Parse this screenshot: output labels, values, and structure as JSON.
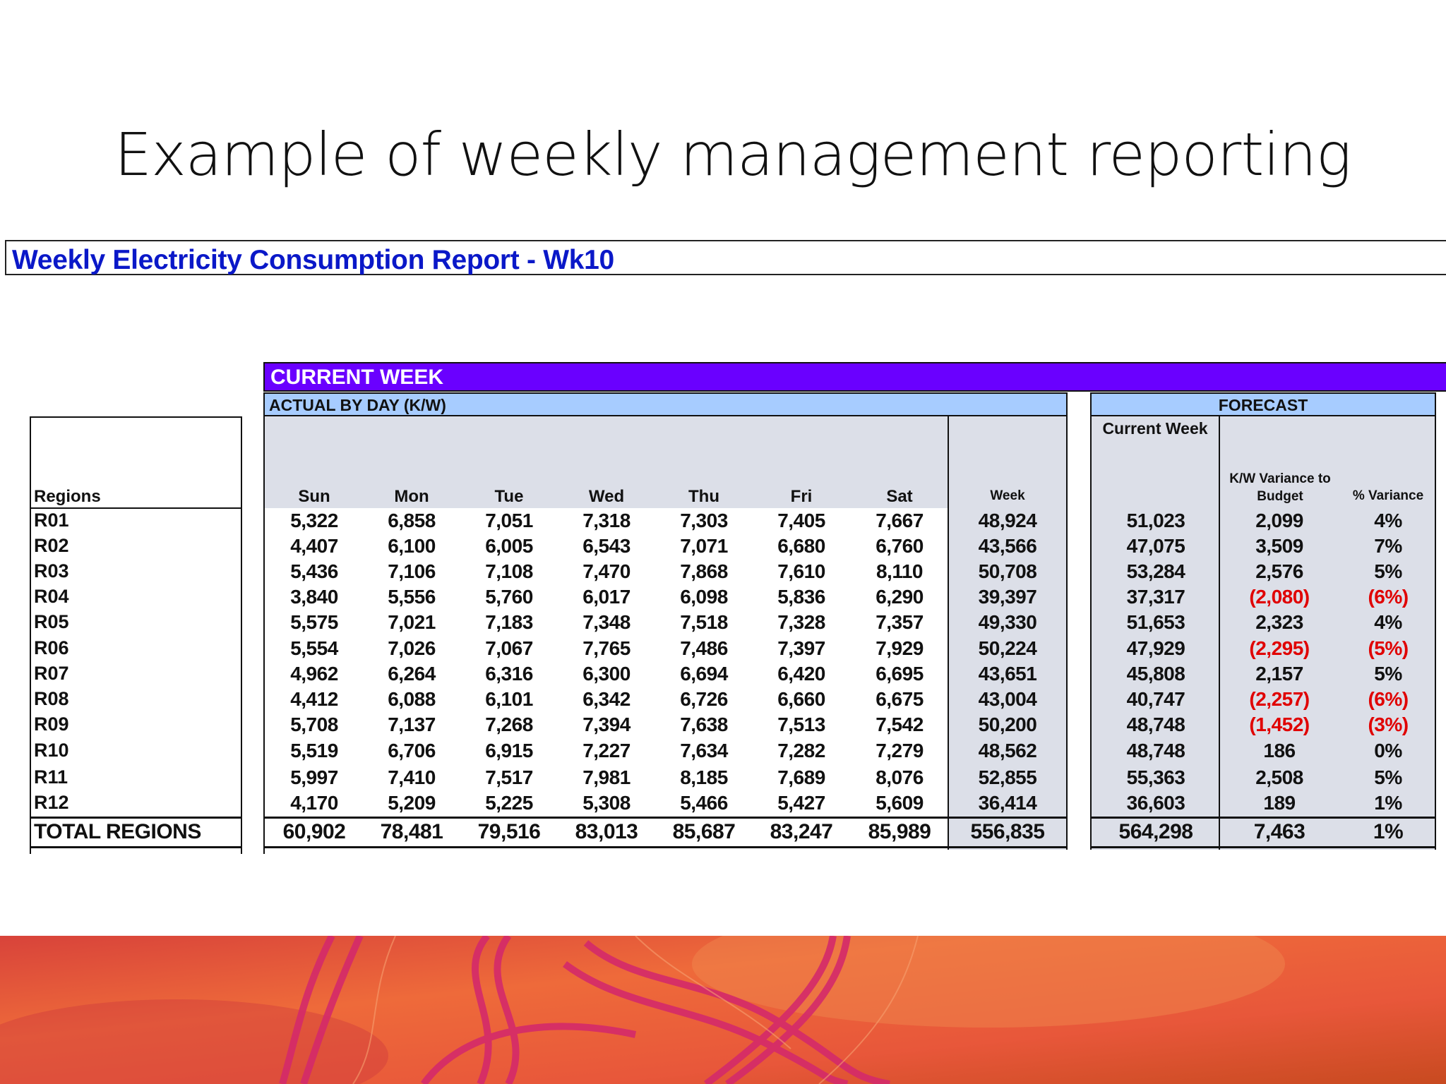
{
  "slide": {
    "title": "Example of weekly management reporting"
  },
  "report": {
    "title": "Weekly Electricity Consumption Report - Wk10",
    "current_week_label": "CURRENT WEEK",
    "actual_label": "ACTUAL BY DAY (K/W)",
    "forecast_label": "FORECAST",
    "headers": {
      "regions": "Regions",
      "days": [
        "Sun",
        "Mon",
        "Tue",
        "Wed",
        "Thu",
        "Fri",
        "Sat"
      ],
      "week": "Week",
      "current_week": "Current Week",
      "kw_variance": "K/W Variance to Budget",
      "pct_variance": "% Variance"
    },
    "rows": [
      {
        "region": "R01",
        "days": [
          "5,322",
          "6,858",
          "7,051",
          "7,318",
          "7,303",
          "7,405",
          "7,667"
        ],
        "week": "48,924",
        "forecast": "51,023",
        "variance": "2,099",
        "pct": "4%",
        "negative": false
      },
      {
        "region": "R02",
        "days": [
          "4,407",
          "6,100",
          "6,005",
          "6,543",
          "7,071",
          "6,680",
          "6,760"
        ],
        "week": "43,566",
        "forecast": "47,075",
        "variance": "3,509",
        "pct": "7%",
        "negative": false
      },
      {
        "region": "R03",
        "days": [
          "5,436",
          "7,106",
          "7,108",
          "7,470",
          "7,868",
          "7,610",
          "8,110"
        ],
        "week": "50,708",
        "forecast": "53,284",
        "variance": "2,576",
        "pct": "5%",
        "negative": false
      },
      {
        "region": "R04",
        "days": [
          "3,840",
          "5,556",
          "5,760",
          "6,017",
          "6,098",
          "5,836",
          "6,290"
        ],
        "week": "39,397",
        "forecast": "37,317",
        "variance": "(2,080)",
        "pct": "(6%)",
        "negative": true
      },
      {
        "region": "R05",
        "days": [
          "5,575",
          "7,021",
          "7,183",
          "7,348",
          "7,518",
          "7,328",
          "7,357"
        ],
        "week": "49,330",
        "forecast": "51,653",
        "variance": "2,323",
        "pct": "4%",
        "negative": false
      },
      {
        "region": "R06",
        "days": [
          "5,554",
          "7,026",
          "7,067",
          "7,765",
          "7,486",
          "7,397",
          "7,929"
        ],
        "week": "50,224",
        "forecast": "47,929",
        "variance": "(2,295)",
        "pct": "(5%)",
        "negative": true
      },
      {
        "region": "R07",
        "days": [
          "4,962",
          "6,264",
          "6,316",
          "6,300",
          "6,694",
          "6,420",
          "6,695"
        ],
        "week": "43,651",
        "forecast": "45,808",
        "variance": "2,157",
        "pct": "5%",
        "negative": false
      },
      {
        "region": "R08",
        "days": [
          "4,412",
          "6,088",
          "6,101",
          "6,342",
          "6,726",
          "6,660",
          "6,675"
        ],
        "week": "43,004",
        "forecast": "40,747",
        "variance": "(2,257)",
        "pct": "(6%)",
        "negative": true
      },
      {
        "region": "R09",
        "days": [
          "5,708",
          "7,137",
          "7,268",
          "7,394",
          "7,638",
          "7,513",
          "7,542"
        ],
        "week": "50,200",
        "forecast": "48,748",
        "variance": "(1,452)",
        "pct": "(3%)",
        "negative": true
      },
      {
        "region": "R10",
        "days": [
          "5,519",
          "6,706",
          "6,915",
          "7,227",
          "7,634",
          "7,282",
          "7,279"
        ],
        "week": "48,562",
        "forecast": "48,748",
        "variance": "186",
        "pct": "0%",
        "negative": false
      },
      {
        "region": "R11",
        "days": [
          "5,997",
          "7,410",
          "7,517",
          "7,981",
          "8,185",
          "7,689",
          "8,076"
        ],
        "week": "52,855",
        "forecast": "55,363",
        "variance": "2,508",
        "pct": "5%",
        "negative": false
      },
      {
        "region": "R12",
        "days": [
          "4,170",
          "5,209",
          "5,225",
          "5,308",
          "5,466",
          "5,427",
          "5,609"
        ],
        "week": "36,414",
        "forecast": "36,603",
        "variance": "189",
        "pct": "1%",
        "negative": false
      }
    ],
    "total": {
      "region": "TOTAL REGIONS",
      "days": [
        "60,902",
        "78,481",
        "79,516",
        "83,013",
        "85,687",
        "83,247",
        "85,989"
      ],
      "week": "556,835",
      "forecast": "564,298",
      "variance": "7,463",
      "pct": "1%"
    },
    "colors": {
      "title_blue": "#0a18c8",
      "current_week_purple": "#6a00ff",
      "subheader_blue": "#a7ccff",
      "cell_gray": "#dcdfe8",
      "negative_red": "#e00000"
    }
  },
  "footer": {
    "art_icon": "abstract-swirl-art",
    "colors": [
      "#e8572f",
      "#d43a5a",
      "#f08a30"
    ]
  }
}
